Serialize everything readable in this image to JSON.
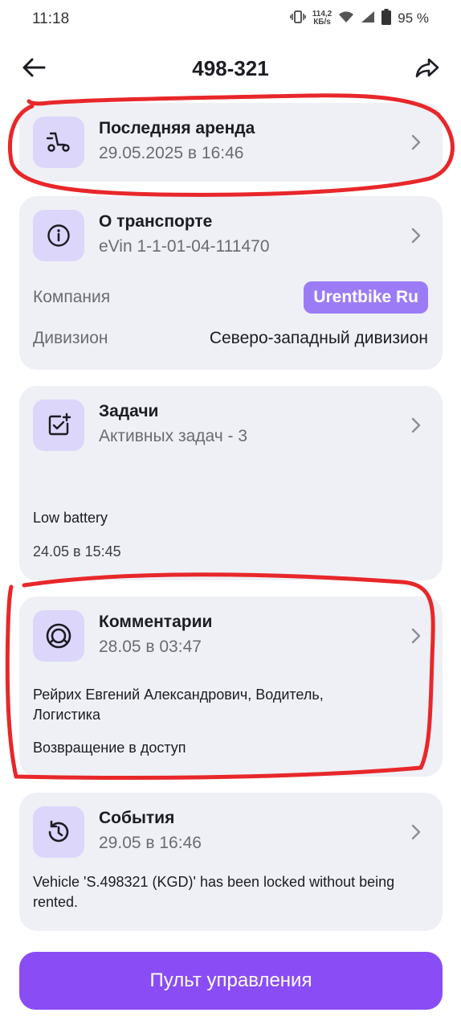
{
  "status_bar": {
    "time": "11:18",
    "speed_value": "114,2",
    "speed_unit": "КБ/s",
    "battery_pct": "95 %",
    "icons": [
      "vibrate-icon",
      "wifi-icon",
      "signal-icon",
      "battery-icon"
    ]
  },
  "header": {
    "title": "498-321",
    "back_icon": "arrow-left-icon",
    "share_icon": "share-icon"
  },
  "last_rental": {
    "title": "Последняя аренда",
    "subtitle": "29.05.2025 в 16:46",
    "icon": "scooter-icon"
  },
  "transport": {
    "title": "О транспорте",
    "subtitle": "eVin 1-1-01-04-111470",
    "icon": "info-icon",
    "company_label": "Компания",
    "company_value": "Urentbike Ru",
    "division_label": "Дивизион",
    "division_value": "Северо-западный дивизион"
  },
  "tasks": {
    "title": "Задачи",
    "subtitle": "Активных задач - 3",
    "icon": "task-add-icon",
    "item_text": "Low battery",
    "item_date": "24.05 в 15:45"
  },
  "comments": {
    "title": "Комментарии",
    "subtitle": "28.05 в 03:47",
    "icon": "comment-ring-icon",
    "author": "Рейрих Евгений Александрович, Водитель, Логистика",
    "text": "Возвращение в доступ"
  },
  "events": {
    "title": "События",
    "subtitle": "29.05 в 16:46",
    "icon": "history-icon",
    "text": "Vehicle 'S.498321 (KGD)' has been locked without being rented."
  },
  "control_button": {
    "label": "Пульт управления"
  },
  "colors": {
    "card_bg": "#eef0f5",
    "icon_bg": "#dcd6fb",
    "accent": "#8a4df5",
    "badge": "#9b7cf6",
    "annotation": "#e8272a"
  }
}
